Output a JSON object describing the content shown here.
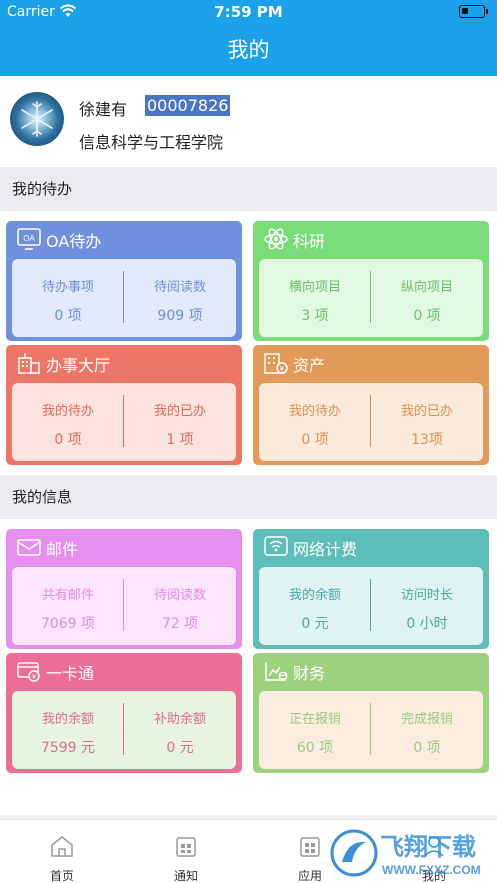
{
  "status_bar": {
    "carrier": "Carrier",
    "time": "7:59 PM"
  },
  "nav": {
    "title": "我的"
  },
  "profile": {
    "name": "徐建有",
    "user_id": "00007826",
    "department": "信息科学与工程学院"
  },
  "sections": {
    "todo_title": "我的待办",
    "info_title": "我的信息"
  },
  "cards": [
    {
      "title": "OA待办",
      "icon": "oa-icon",
      "color": "#6f8fdf",
      "body": "#e2eaf9",
      "text": "#6f8fdf",
      "left_label": "待办事项",
      "left_value": "0 项",
      "right_label": "待阅读数",
      "right_value": "909 项"
    },
    {
      "title": "科研",
      "icon": "atom-icon",
      "color": "#78dc78",
      "body": "#e2f8e2",
      "text": "#68c468",
      "left_label": "横向项目",
      "left_value": "3 项",
      "right_label": "纵向项目",
      "right_value": "0 项"
    },
    {
      "title": "办事大厅",
      "icon": "hall-icon",
      "color": "#ec7766",
      "body": "#fbe3df",
      "text": "#e06a5a",
      "left_label": "我的待办",
      "left_value": "0 项",
      "right_label": "我的已办",
      "right_value": "1 项"
    },
    {
      "title": "资产",
      "icon": "asset-icon",
      "color": "#e19a57",
      "body": "#faeadb",
      "text": "#db9150",
      "left_label": "我的待办",
      "left_value": "0 项",
      "right_label": "我的已办",
      "right_value": "13项"
    },
    {
      "title": "邮件",
      "icon": "mail-icon",
      "color": "#e68ff0",
      "body": "#fbe6fd",
      "text": "#e08bea",
      "left_label": "共有邮件",
      "left_value": "7069 项",
      "right_label": "待阅读数",
      "right_value": "72 项"
    },
    {
      "title": "网络计费",
      "icon": "network-icon",
      "color": "#5dbdb7",
      "body": "#dff3f2",
      "text": "#4aa9a3",
      "left_label": "我的余额",
      "left_value": "0 元",
      "right_label": "访问时长",
      "right_value": "0 小时"
    },
    {
      "title": "一卡通",
      "icon": "card-icon",
      "color": "#ec6d95",
      "body": "#e7f5e0",
      "text": "#e36a90",
      "left_label": "我的余额",
      "left_value": "7599 元",
      "right_label": "补助余额",
      "right_value": "0 元"
    },
    {
      "title": "财务",
      "icon": "finance-icon",
      "color": "#9ed17e",
      "body": "#fbece0",
      "text": "#9ac97c",
      "left_label": "正在报销",
      "left_value": "60 项",
      "right_label": "完成报销",
      "right_value": "0 项"
    }
  ],
  "tabs": [
    {
      "label": "首页",
      "icon": "home-icon"
    },
    {
      "label": "通知",
      "icon": "notice-icon"
    },
    {
      "label": "应用",
      "icon": "apps-icon"
    },
    {
      "label": "我的",
      "icon": "profile-icon"
    }
  ],
  "watermark": {
    "brand": "飞翔下载",
    "url": "WWW.FXXZ.COM"
  }
}
